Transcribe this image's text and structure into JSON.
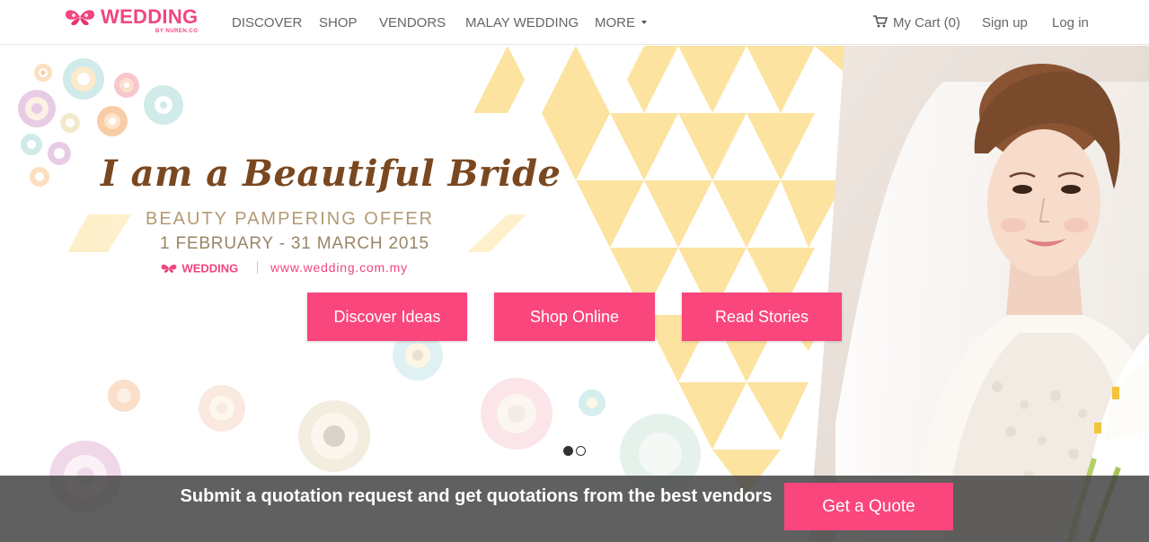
{
  "brand": {
    "name": "WEDDING",
    "tagline": "BY NUREN.CO"
  },
  "nav": {
    "discover": "DISCOVER",
    "shop": "SHOP",
    "vendors": "VENDORS",
    "malay_wedding": "MALAY WEDDING",
    "more": "MORE",
    "cart": "My Cart (0)",
    "signup": "Sign up",
    "login": "Log in"
  },
  "banner": {
    "headline": "I am a Beautiful Bride",
    "offer": "BEAUTY PAMPERING OFFER",
    "dates": "1  FEBRUARY - 31 MARCH 2015",
    "brand": "WEDDING",
    "url": "www.wedding.com.my"
  },
  "cta": {
    "discover": "Discover Ideas",
    "shop": "Shop Online",
    "stories": "Read Stories"
  },
  "carousel": {
    "slide_count": 2,
    "active_slide": 1
  },
  "quote": {
    "text": "Submit a quotation request and get quotations from the best vendors",
    "button": "Get a Quote"
  },
  "colors": {
    "brand_pink": "#f9467d",
    "triangle_yellow": "#fde3a0",
    "headline_brown": "#7a4820",
    "offer_tan": "#b49a73",
    "quote_bar": "#464646"
  }
}
